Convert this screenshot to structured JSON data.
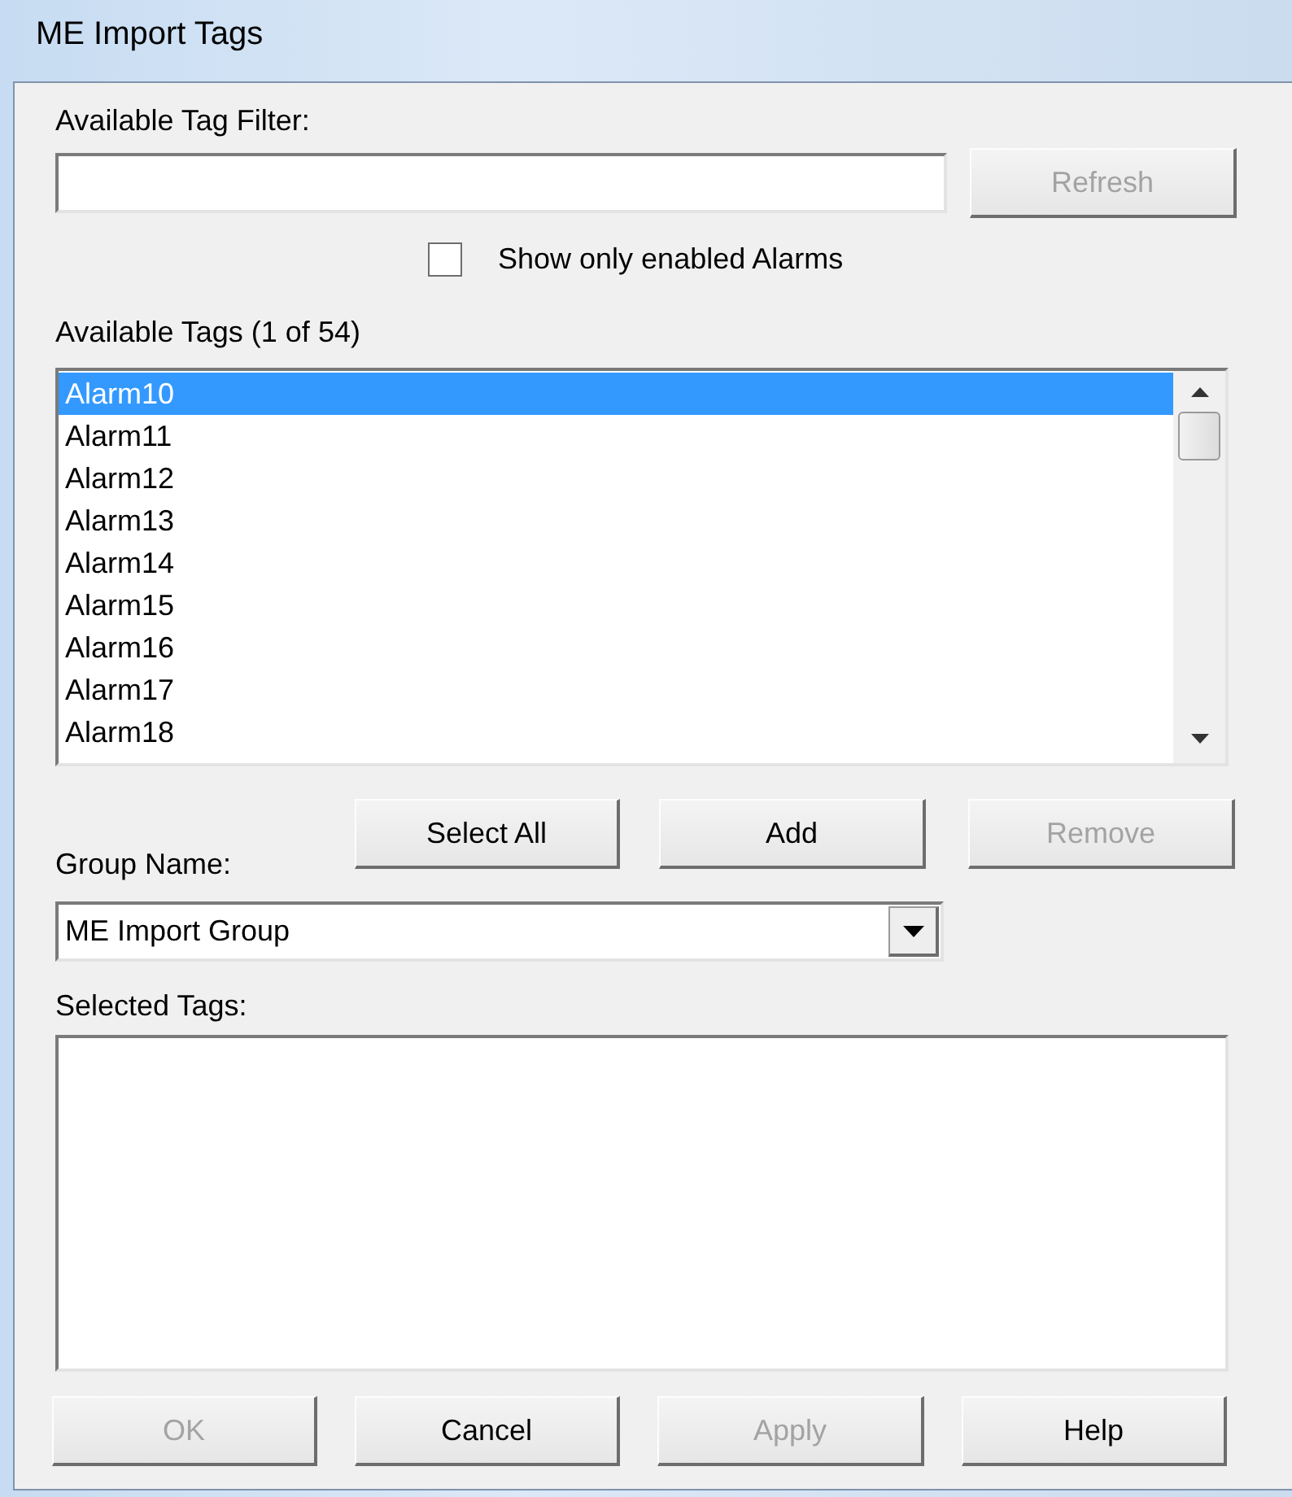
{
  "window": {
    "title": "ME Import Tags"
  },
  "filter": {
    "label": "Available Tag Filter:"
  },
  "refresh_button": {
    "label": "Refresh",
    "disabled": true
  },
  "show_enabled_only": {
    "label": "Show only enabled Alarms",
    "checked": false
  },
  "available_tags": {
    "label": "Available Tags (1 of 54)",
    "items": [
      {
        "text": "Alarm10",
        "selected": true
      },
      {
        "text": "Alarm11",
        "selected": false
      },
      {
        "text": "Alarm12",
        "selected": false
      },
      {
        "text": "Alarm13",
        "selected": false
      },
      {
        "text": "Alarm14",
        "selected": false
      },
      {
        "text": "Alarm15",
        "selected": false
      },
      {
        "text": "Alarm16",
        "selected": false
      },
      {
        "text": "Alarm17",
        "selected": false
      },
      {
        "text": "Alarm18",
        "selected": false
      }
    ]
  },
  "list_buttons": [
    {
      "label": "Select All",
      "disabled": false
    },
    {
      "label": "Add",
      "disabled": false
    },
    {
      "label": "Remove",
      "disabled": true
    }
  ],
  "group_name": {
    "label": "Group Name:",
    "value": "ME Import Group"
  },
  "selected_tags": {
    "label": "Selected Tags:"
  },
  "buttons": [
    {
      "label": "OK",
      "disabled": true
    },
    {
      "label": "Cancel",
      "disabled": false
    },
    {
      "label": "Apply",
      "disabled": true
    },
    {
      "label": "Help",
      "disabled": false
    }
  ]
}
